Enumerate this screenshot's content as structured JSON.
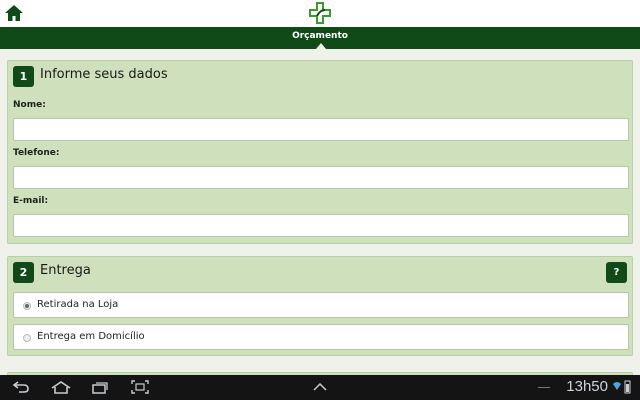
{
  "header": {
    "home_icon": "home-icon",
    "logo_icon": "pharmacy-cross-logo-icon",
    "title": "Orçamento"
  },
  "section1": {
    "number": "1",
    "title": "Informe seus dados",
    "fields": [
      {
        "label": "Nome:",
        "value": "",
        "placeholder": ""
      },
      {
        "label": "Telefone:",
        "value": "",
        "placeholder": ""
      },
      {
        "label": "E-mail:",
        "value": "",
        "placeholder": ""
      }
    ]
  },
  "section2": {
    "number": "2",
    "title": "Entrega",
    "help_label": "?",
    "options": [
      {
        "label": "Retirada na Loja",
        "checked": true
      },
      {
        "label": "Entrega em Domicílio",
        "checked": false
      }
    ]
  },
  "system_bar": {
    "clock": "13h50",
    "icons": [
      "back-icon",
      "home-icon",
      "recent-apps-icon",
      "screenshot-icon",
      "up-arrow-icon",
      "wifi-icon",
      "battery-icon"
    ]
  },
  "colors": {
    "brand_dark_green": "#0f4a18",
    "section_bg": "#cfe0bc",
    "page_bg": "#eef2ea",
    "logo_green": "#3a9a2c"
  }
}
